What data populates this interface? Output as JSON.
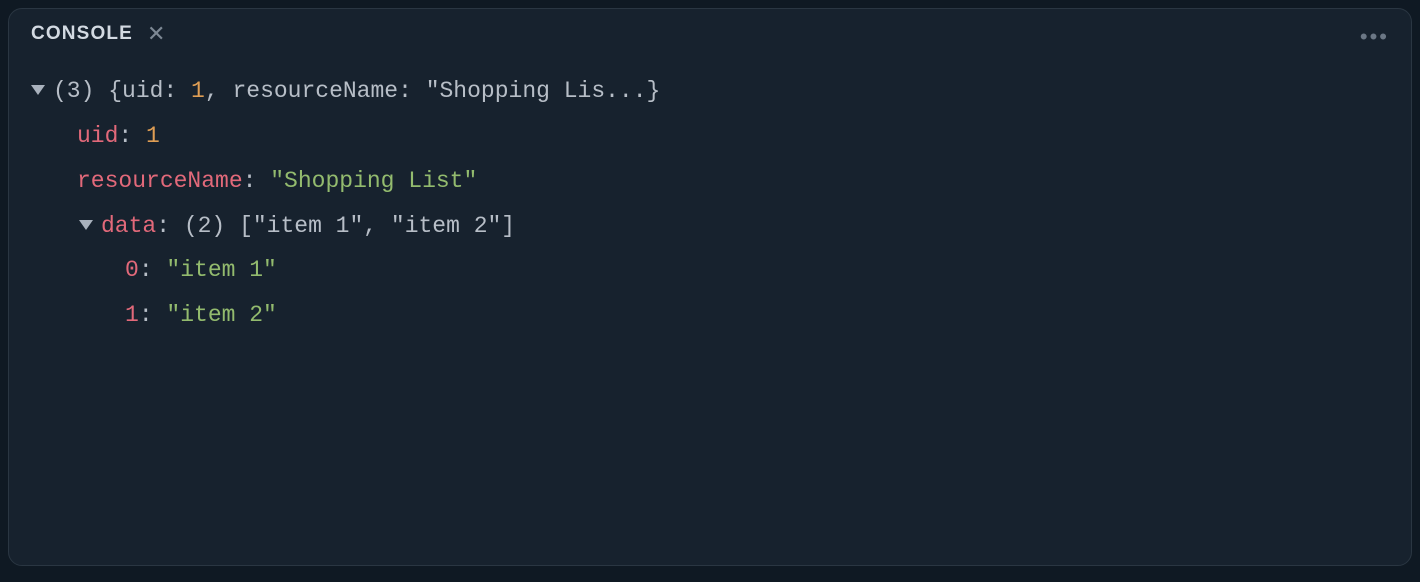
{
  "panel": {
    "title": "CONSOLE",
    "close_glyph": "✕",
    "more_glyph": "•••"
  },
  "root": {
    "count": "(3)",
    "summary_open": " {uid: ",
    "summary_uid": "1",
    "summary_mid": ", resourceName: ",
    "summary_name": "\"Shopping Lis...}"
  },
  "entries": {
    "uid_key": "uid",
    "uid_val": "1",
    "rn_key": "resourceName",
    "rn_val": "\"Shopping List\"",
    "data_key": "data",
    "data_count": "(2)",
    "data_preview": "[\"item 1\", \"item 2\"]"
  },
  "data_items": {
    "k0": "0",
    "v0": "\"item 1\"",
    "k1": "1",
    "v1": "\"item 2\""
  },
  "sep_colon": ": ",
  "sep_colon_sp": ":"
}
